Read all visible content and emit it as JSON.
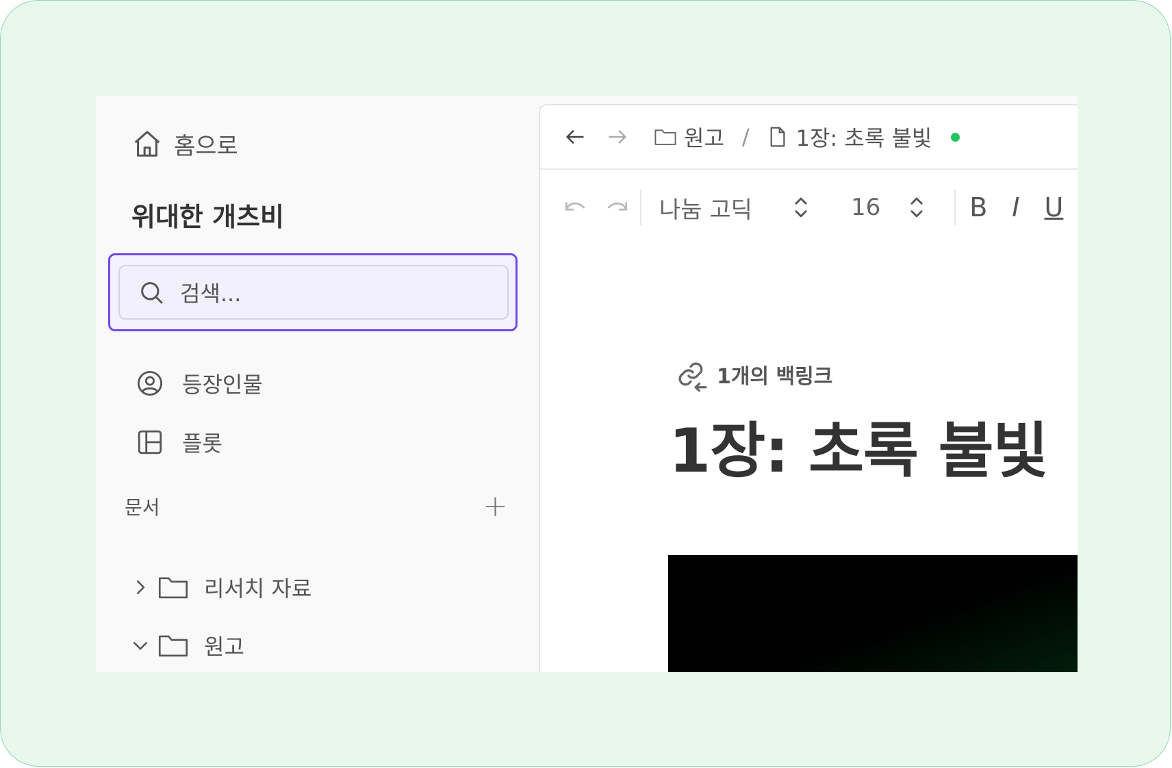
{
  "sidebar": {
    "home_label": "홈으로",
    "project_title": "위대한 개츠비",
    "search_placeholder": "검색...",
    "nav": [
      {
        "label": "등장인물",
        "icon": "user-circle-icon"
      },
      {
        "label": "플롯",
        "icon": "layout-icon"
      }
    ],
    "section_label": "문서",
    "add_symbol": "+",
    "tree": [
      {
        "label": "리서치 자료",
        "expanded": false
      },
      {
        "label": "원고",
        "expanded": true
      }
    ]
  },
  "topbar": {
    "folder_crumb": "원고",
    "separator": "/",
    "doc_crumb": "1장: 초록 불빛",
    "status_color": "#22c55e"
  },
  "toolbar": {
    "font_family": "나눔 고딕",
    "font_size": "16",
    "bold": "B",
    "italic": "I",
    "underline": "U"
  },
  "document": {
    "backlinks": "1개의 백링크",
    "title": "1장: 초록 불빛"
  },
  "colors": {
    "accent": "#6e4be2",
    "frame_bg": "#e8f8ec",
    "frame_border": "#93d6b4"
  }
}
